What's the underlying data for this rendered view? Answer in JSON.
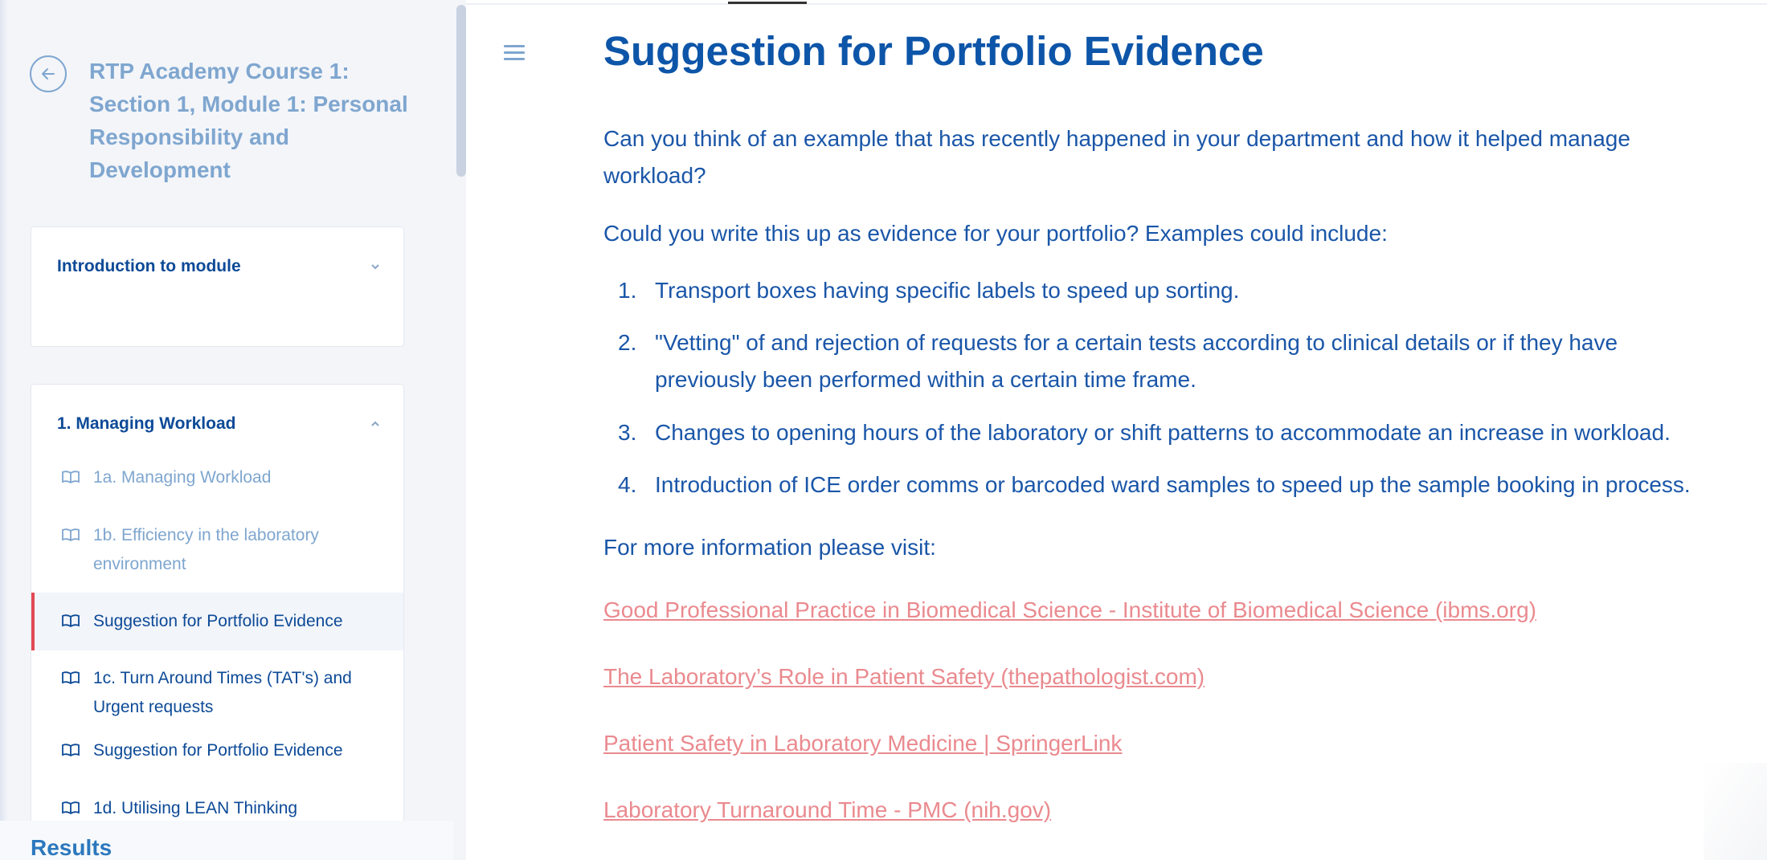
{
  "sidebar": {
    "course_title": "RTP Academy Course 1: Section 1, Module 1: Personal Responsibility and Development",
    "back_icon": "arrow-left-icon",
    "sections": [
      {
        "title": "Introduction to module",
        "expanded": false
      },
      {
        "title": "1. Managing Workload",
        "expanded": true
      }
    ],
    "lessons": [
      {
        "label": "1a. Managing Workload",
        "state": "completed"
      },
      {
        "label": "1b. Efficiency in the laboratory environment",
        "state": "completed"
      },
      {
        "label": "Suggestion for Portfolio Evidence",
        "state": "active"
      },
      {
        "label": "1c. Turn Around Times (TAT's) and Urgent requests",
        "state": "default"
      },
      {
        "label": "Suggestion for Portfolio Evidence",
        "state": "default"
      },
      {
        "label": "1d. Utilising LEAN Thinking",
        "state": "default"
      }
    ],
    "results_label": "Results"
  },
  "main": {
    "menu_icon": "hamburger-menu-icon",
    "title": "Suggestion for Portfolio Evidence",
    "intro_paragraph": "Can you think of an example that has recently happened in your department and how it helped manage workload?",
    "question_paragraph": "Could you write this up as evidence for your portfolio?  Examples could include:",
    "examples": [
      {
        "num": "1.",
        "text": "Transport boxes having specific labels to speed up sorting."
      },
      {
        "num": "2.",
        "text": "\"Vetting\" of and rejection of requests for a certain tests according to clinical details or if they have previously been performed within a certain time frame."
      },
      {
        "num": "3.",
        "text": "Changes to opening hours of the laboratory or shift patterns to accommodate an increase in workload."
      },
      {
        "num": "4.",
        "text": "Introduction of ICE order comms or barcoded ward samples to speed up the sample booking in process."
      }
    ],
    "more_info_label": "For more information please visit:",
    "links": [
      "Good Professional Practice in Biomedical Science - Institute of Biomedical Science (ibms.org)",
      "The Laboratory’s Role in Patient Safety (thepathologist.com)",
      "Patient Safety in Laboratory Medicine | SpringerLink",
      "Laboratory Turnaround Time - PMC (nih.gov)"
    ]
  },
  "colors": {
    "primary": "#0d55a8",
    "muted_blue": "#7fa6cf",
    "link": "#ea8a8f",
    "active_marker": "#e34a54"
  }
}
